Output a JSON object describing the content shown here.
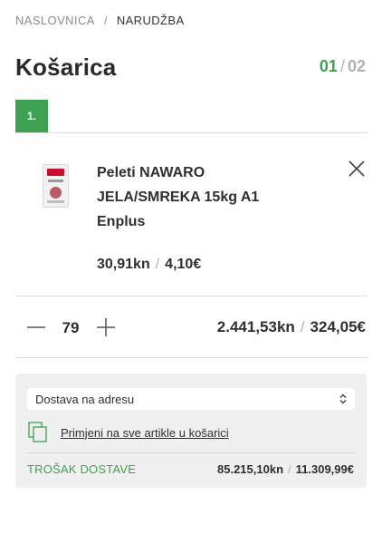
{
  "breadcrumb": {
    "home": "NASLOVNICA",
    "separator": "/",
    "current": "NARUDŽBA"
  },
  "page": {
    "title": "Košarica"
  },
  "steps": {
    "current": "01",
    "separator": "/",
    "total": "02",
    "badge": "1."
  },
  "cart_item": {
    "name": "Peleti NAWARO JELA/SMREKA 15kg A1 Enplus",
    "price_kn": "30,91kn",
    "price_eur": "4,10€",
    "quantity": "79",
    "total_kn": "2.441,53kn",
    "total_eur": "324,05€",
    "separator": "/"
  },
  "delivery": {
    "selected_option": "Dostava na adresu",
    "apply_all_label": "Primjeni na sve artikle u košarici",
    "shipping_label": "TROŠAK DOSTAVE",
    "shipping_kn": "85.215,10kn",
    "shipping_eur": "11.309,99€",
    "separator": "/"
  },
  "colors": {
    "accent": "#3ea151",
    "panel": "#f0f0f0",
    "divider": "#dcdcdc"
  },
  "icons": [
    "close-icon",
    "minus-icon",
    "plus-icon",
    "chevron-updown-icon",
    "copy-icon"
  ]
}
